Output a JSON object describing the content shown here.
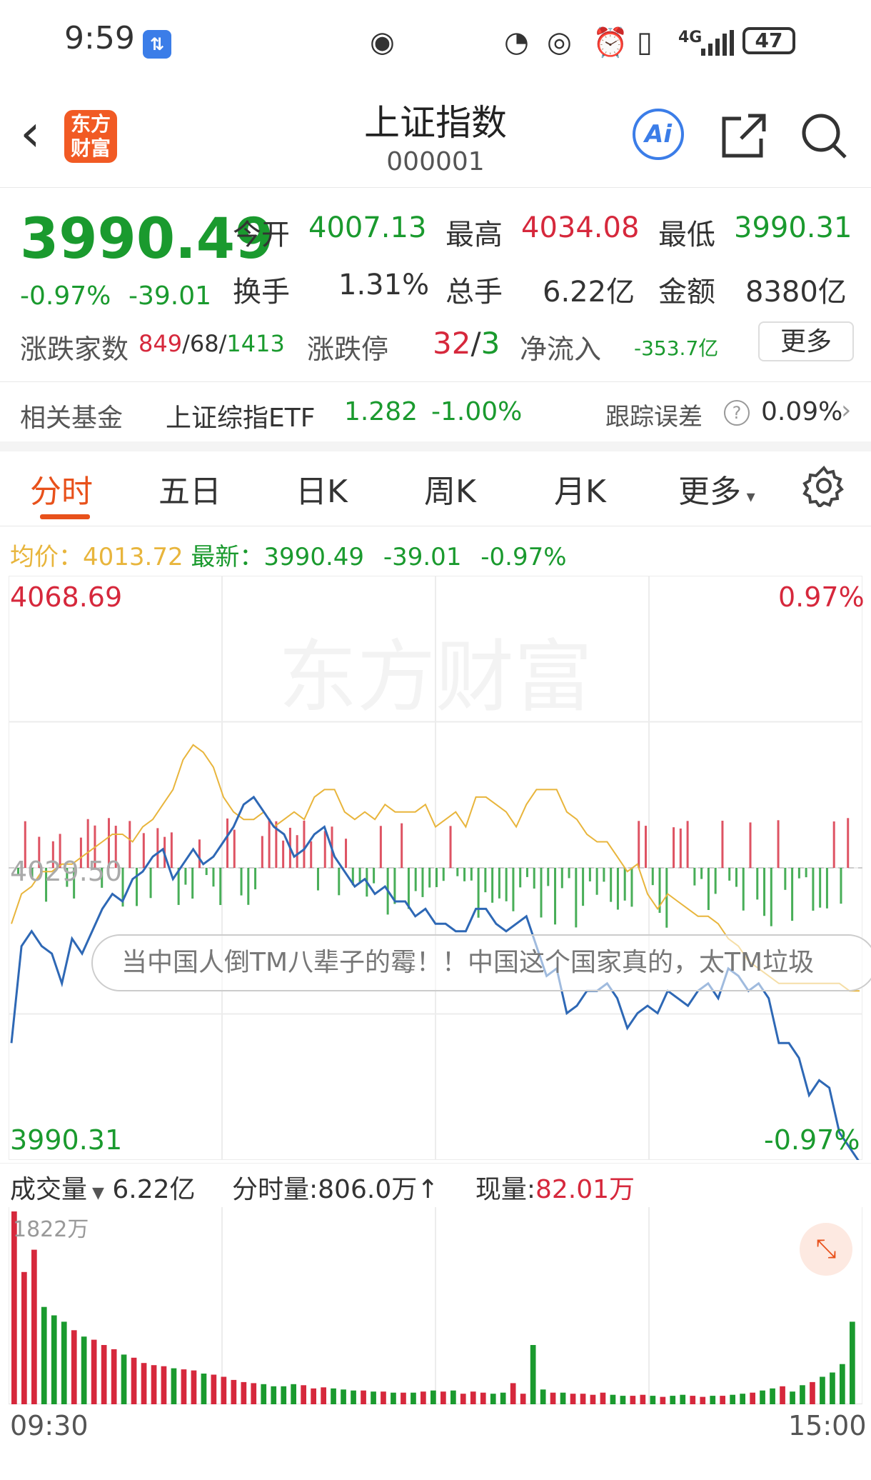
{
  "status_bar": {
    "time": "9:59",
    "badge": "⇅",
    "battery": "47",
    "network": "4G"
  },
  "header": {
    "title": "上证指数",
    "code": "000001",
    "ai_label": "Ai",
    "logo_line1": "东方",
    "logo_line2": "财富"
  },
  "quote": {
    "price": "3990.49",
    "change_pct": "-0.97%",
    "change": "-39.01",
    "open_label": "今开",
    "open": "4007.13",
    "high_label": "最高",
    "high": "4034.08",
    "low_label": "最低",
    "low": "3990.31",
    "turnover_label": "换手",
    "turnover": "1.31%",
    "volume_label": "总手",
    "volume": "6.22亿",
    "amount_label": "金额",
    "amount": "8380亿",
    "breadth_label": "涨跌家数",
    "up_count": "849",
    "flat_count": "68",
    "down_count": "1413",
    "limit_label": "涨跌停",
    "limit_up": "32",
    "limit_down": "3",
    "net_inflow_label": "净流入",
    "net_inflow": "-353.7亿",
    "more": "更多"
  },
  "fund": {
    "label": "相关基金",
    "name": "上证综指ETF",
    "price": "1.282",
    "change": "-1.00%",
    "tracking_label": "跟踪误差",
    "tracking": "0.09%"
  },
  "tabs": [
    "分时",
    "五日",
    "日K",
    "周K",
    "月K",
    "更多"
  ],
  "chart_info": {
    "avg_label": "均价：",
    "avg": "4013.72",
    "latest_label": "最新：",
    "latest": "3990.49",
    "latest_change": "-39.01",
    "latest_pct": "-0.97%"
  },
  "chart_axis": {
    "top": "4068.69",
    "mid": "4029.50",
    "bottom": "3990.31",
    "top_pct": "0.97%",
    "bottom_pct": "-0.97%"
  },
  "ticker": "当中国人倒TM八辈子的霉！！中国这个国家真的，太TM垃圾",
  "volume_info": {
    "label": "成交量",
    "total": "6.22亿",
    "minute_label": "分时量:",
    "minute": "806.0万",
    "arrow": "↑",
    "current_label": "现量:",
    "current": "82.01万"
  },
  "volume_axis": {
    "max": "1822万",
    "start": "09:30",
    "end": "15:00"
  },
  "colors": {
    "up": "#d6283c",
    "down": "#1a9a2e",
    "price_line": "#2e68b5",
    "avg_line": "#e8b53c",
    "accent": "#e8511b"
  },
  "chart_data": {
    "type": "line",
    "x_range": [
      "09:30",
      "15:00"
    ],
    "ylim": [
      3990.31,
      4068.69
    ],
    "reference": 4029.5,
    "series": [
      {
        "values": [
          4006,
          4019,
          4021,
          4019,
          4018,
          4014,
          4020,
          4018,
          4021,
          4024,
          4026,
          4025,
          4028,
          4029,
          4031,
          4032,
          4028,
          4030,
          4032,
          4030,
          4031,
          4033,
          4035,
          4038,
          4039,
          4037,
          4035,
          4034,
          4031,
          4032,
          4034,
          4035,
          4031,
          4029,
          4027,
          4028,
          4026,
          4027,
          4025,
          4025,
          4023,
          4024,
          4022,
          4022,
          4021,
          4021,
          4024,
          4024,
          4022,
          4021,
          4022,
          4023,
          4019,
          4015,
          4016,
          4010,
          4011,
          4013,
          4013,
          4014,
          4012,
          4008,
          4010,
          4011,
          4010,
          4013,
          4012,
          4011,
          4013,
          4014,
          4012,
          4016,
          4015,
          4013,
          4014,
          4012,
          4006,
          4006,
          4004,
          3999,
          4001,
          4000,
          3994,
          3992,
          3990
        ]
      },
      {
        "values": [
          4022,
          4026,
          4027,
          4029,
          4029,
          4030,
          4030,
          4031,
          4032,
          4033,
          4034,
          4034,
          4033,
          4035,
          4036,
          4038,
          4040,
          4044,
          4046,
          4045,
          4043,
          4039,
          4037,
          4036,
          4036,
          4037,
          4035,
          4036,
          4037,
          4036,
          4039,
          4040,
          4040,
          4037,
          4036,
          4037,
          4036,
          4038,
          4037,
          4037,
          4037,
          4038,
          4035,
          4036,
          4037,
          4035,
          4039,
          4039,
          4038,
          4037,
          4035,
          4038,
          4040,
          4040,
          4040,
          4037,
          4036,
          4034,
          4033,
          4033,
          4031,
          4029,
          4030,
          4026,
          4024,
          4026,
          4025,
          4024,
          4023,
          4023,
          4022,
          4020,
          4019,
          4017,
          4016,
          4015,
          4014,
          4014,
          4014,
          4014,
          4014,
          4014,
          4014,
          4013,
          4013
        ]
      }
    ],
    "volume": [
      1822,
      1250,
      1460,
      920,
      840,
      780,
      700,
      640,
      610,
      560,
      520,
      470,
      440,
      390,
      370,
      360,
      340,
      330,
      320,
      290,
      280,
      260,
      230,
      210,
      200,
      190,
      170,
      170,
      190,
      180,
      150,
      160,
      150,
      140,
      130,
      130,
      120,
      120,
      110,
      110,
      110,
      120,
      130,
      120,
      130,
      100,
      120,
      110,
      100,
      110,
      200,
      100,
      560,
      140,
      110,
      110,
      100,
      100,
      90,
      110,
      90,
      80,
      80,
      90,
      80,
      70,
      80,
      90,
      80,
      70,
      80,
      80,
      90,
      100,
      110,
      130,
      150,
      170,
      120,
      180,
      210,
      260,
      300,
      380,
      780
    ]
  }
}
